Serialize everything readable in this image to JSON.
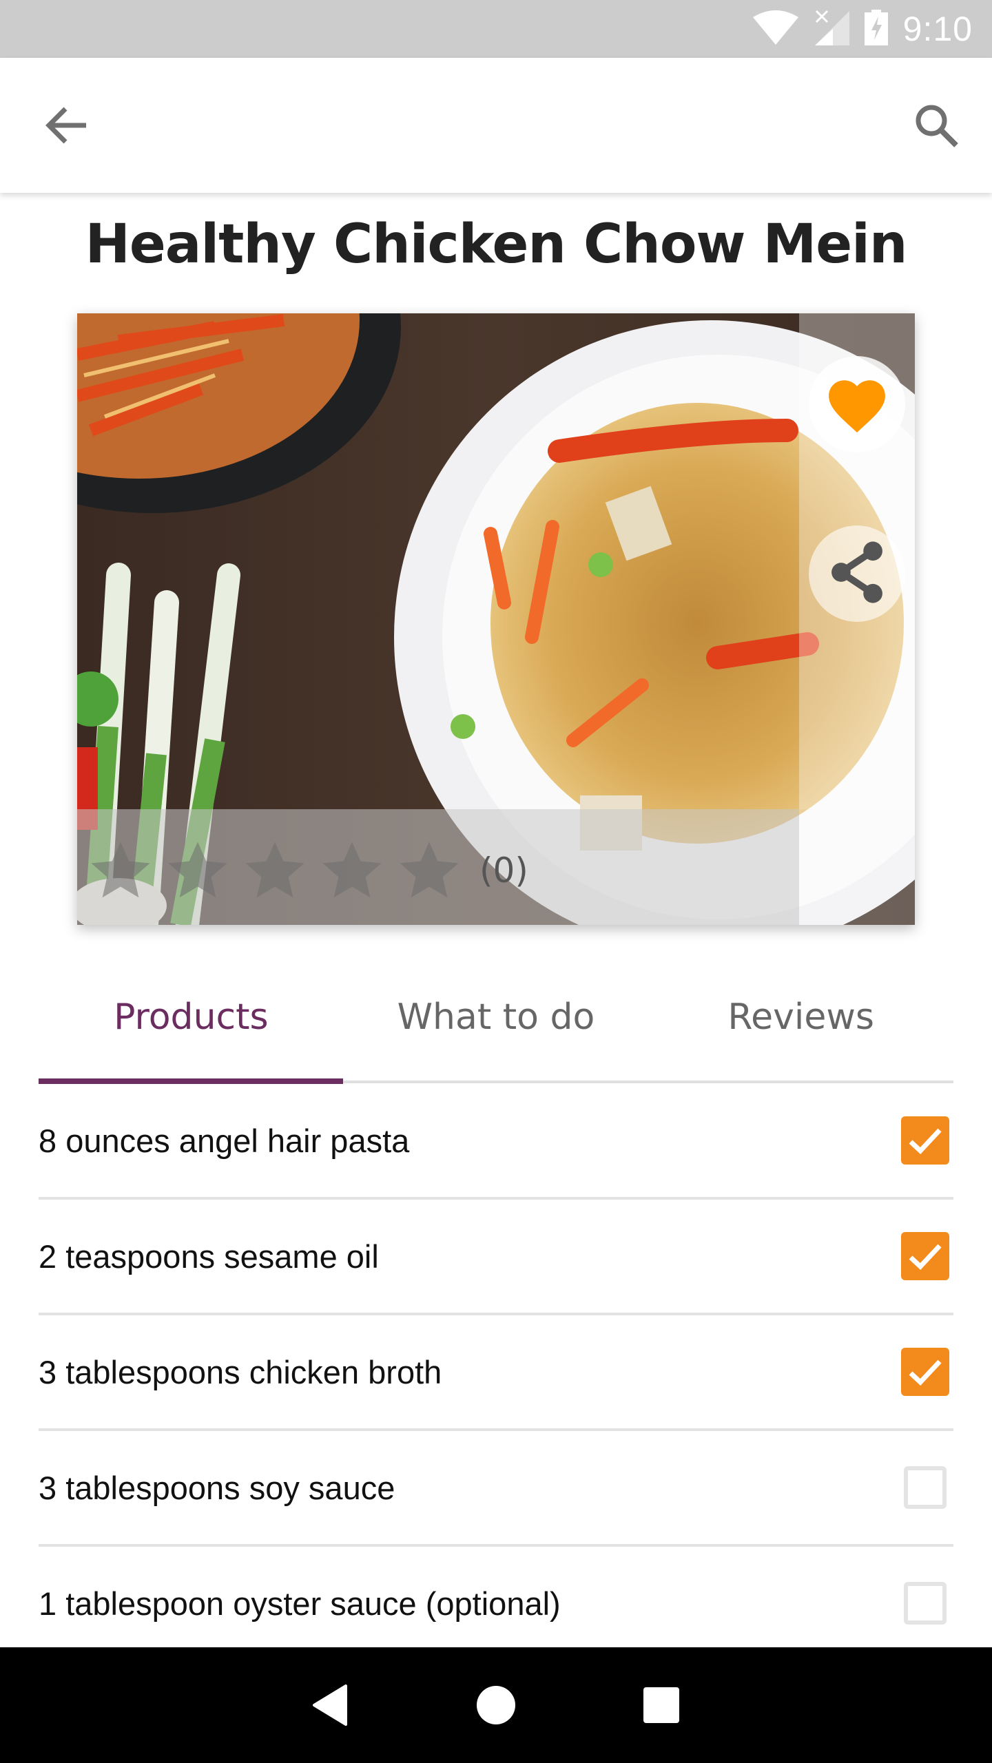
{
  "status_bar": {
    "time": "9:10",
    "icons": [
      "wifi-icon",
      "cell-signal-no-data-icon",
      "battery-charging-icon"
    ]
  },
  "app_bar": {
    "back_icon": "arrow-back-icon",
    "search_icon": "search-icon"
  },
  "recipe": {
    "title": "Healthy Chicken Chow Mein",
    "image_alt": "Chicken chow mein noodles with peppers and carrots in a white bowl",
    "favorite": true,
    "rating": {
      "value": 0,
      "max": 5,
      "count_label": "(0)"
    }
  },
  "actions": {
    "favorite_icon": "heart-icon",
    "share_icon": "share-icon"
  },
  "tabs": [
    {
      "label": "Products",
      "active": true
    },
    {
      "label": "What to do",
      "active": false
    },
    {
      "label": "Reviews",
      "active": false
    }
  ],
  "ingredients": [
    {
      "label": "8 ounces angel hair pasta",
      "checked": true
    },
    {
      "label": "2 teaspoons sesame oil",
      "checked": true
    },
    {
      "label": "3 tablespoons chicken broth",
      "checked": true
    },
    {
      "label": "3 tablespoons soy sauce",
      "checked": false
    },
    {
      "label": "1 tablespoon oyster sauce (optional)",
      "checked": false
    }
  ],
  "colors": {
    "accent": "#6b2d5f",
    "checkbox": "#f38b1c",
    "favorite": "#ff9800",
    "status_bar": "#cccccc"
  },
  "nav_bar": {
    "buttons": [
      "back-icon",
      "home-icon",
      "recents-icon"
    ]
  }
}
